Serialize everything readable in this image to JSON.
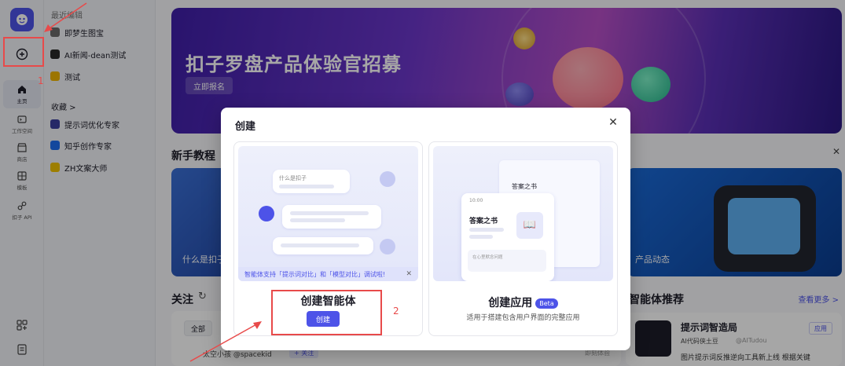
{
  "rail": {
    "items": [
      {
        "label": "主页",
        "icon": "home-icon"
      },
      {
        "label": "工作空间",
        "icon": "workspace-icon"
      },
      {
        "label": "商店",
        "icon": "store-icon"
      },
      {
        "label": "模板",
        "icon": "template-icon"
      },
      {
        "label": "扣子 API",
        "icon": "api-icon"
      }
    ]
  },
  "sidebar": {
    "recent_title": "最近编辑",
    "recent": [
      {
        "label": "即梦生图宝",
        "color": "#6b6b6b"
      },
      {
        "label": "AI新闻-dean测试",
        "color": "#2a2a2a"
      },
      {
        "label": "测试",
        "color": "#f0b400"
      }
    ],
    "favorites_title": "收藏 >",
    "favorites": [
      {
        "label": "提示词优化专家",
        "color": "#3b3f9e"
      },
      {
        "label": "知乎创作专家",
        "color": "#1e6ef2"
      },
      {
        "label": "ZH文案大师",
        "color": "#f2c200"
      }
    ]
  },
  "banner": {
    "title": "扣子罗盘产品体验官招募",
    "button": "立即报名"
  },
  "tutorial": {
    "title": "新手教程",
    "card1_label": "什么是扣子",
    "card2_label": "产品动态"
  },
  "follow": {
    "title": "关注",
    "tab_all": "全部",
    "row_text": "太空小孩 @spacekid",
    "follow_btn": "+ 关注",
    "row_right": "即刻体验"
  },
  "recommend": {
    "title": "智能体推荐",
    "more": "查看更多 >",
    "item_title": "提示词智造局",
    "item_author": "AI代码侠土豆",
    "item_handle": "@AITudou",
    "item_tag": "应用",
    "item_desc": "图片提示词反推逆向工具新上线 根据关键"
  },
  "modal": {
    "title": "创建",
    "agent": {
      "title": "创建智能体",
      "button": "创建",
      "notice": "智能体支持「提示词对比」和「模型对比」调试啦!",
      "chat_placeholder": "什么是扣子"
    },
    "app": {
      "title": "创建应用",
      "badge": "Beta",
      "subtitle": "适用于搭建包含用户界面的完整应用",
      "phone_time": "10:00",
      "book_title": "答案之书",
      "input_hint": "在心里默念问题"
    }
  },
  "annotations": {
    "step1": "1",
    "step2": "2"
  }
}
